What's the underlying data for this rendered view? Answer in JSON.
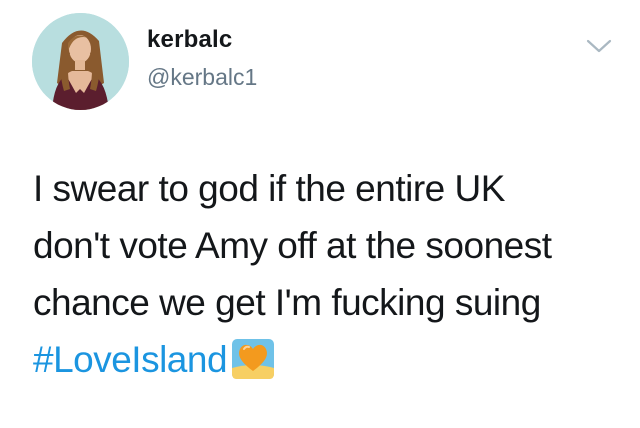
{
  "user": {
    "display_name": "kerbalc",
    "handle": "@kerbalc1"
  },
  "tweet": {
    "lines": [
      "I swear to god if the entire UK",
      "don't vote Amy off at the soonest",
      "chance we get I'm fucking suing"
    ],
    "hashtag": "#LoveIsland",
    "emoji": "orange-heart-island-emoji"
  },
  "icons": {
    "menu": "chevron-down-icon"
  },
  "colors": {
    "text": "#14171a",
    "secondary": "#657786",
    "link": "#1b95e0"
  }
}
